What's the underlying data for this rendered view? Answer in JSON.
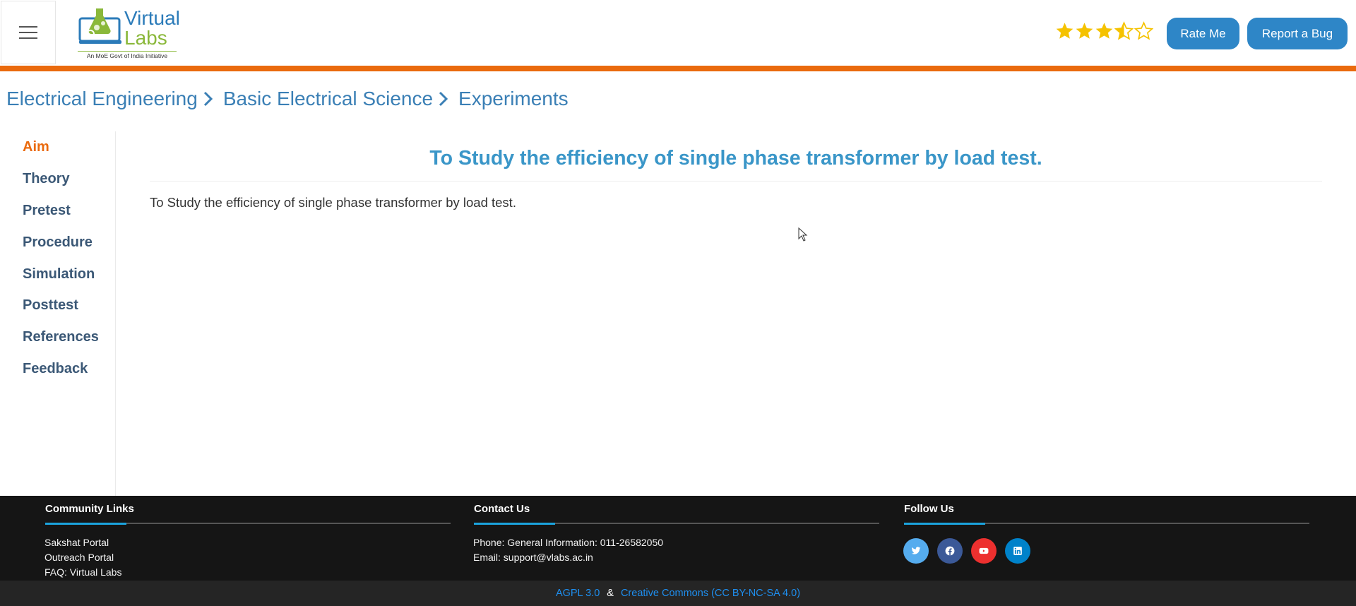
{
  "header": {
    "logo_word1": "Virtual",
    "logo_word2": "Labs",
    "logo_tagline": "An MoE Govt of India Initiative",
    "rating": 3.5,
    "rating_max": 5,
    "rate_me_label": "Rate Me",
    "report_bug_label": "Report a Bug",
    "accent_color": "#ea6a0d",
    "button_color": "#2e86c7",
    "star_color": "#f5c200"
  },
  "breadcrumb": [
    "Electrical Engineering",
    "Basic Electrical Science",
    "Experiments"
  ],
  "sidebar": {
    "items": [
      {
        "label": "Aim",
        "active": true
      },
      {
        "label": "Theory",
        "active": false
      },
      {
        "label": "Pretest",
        "active": false
      },
      {
        "label": "Procedure",
        "active": false
      },
      {
        "label": "Simulation",
        "active": false
      },
      {
        "label": "Posttest",
        "active": false
      },
      {
        "label": "References",
        "active": false
      },
      {
        "label": "Feedback",
        "active": false
      }
    ]
  },
  "main": {
    "title": "To Study the efficiency of single phase transformer by load test.",
    "text": "To Study the efficiency of single phase transformer by load test."
  },
  "footer": {
    "community": {
      "heading": "Community Links",
      "links": [
        "Sakshat Portal",
        "Outreach Portal",
        "FAQ: Virtual Labs"
      ]
    },
    "contact": {
      "heading": "Contact Us",
      "lines": [
        "Phone: General Information: 011-26582050",
        "Email: support@vlabs.ac.in"
      ]
    },
    "follow": {
      "heading": "Follow Us",
      "icons": [
        {
          "name": "twitter-icon",
          "color": "#55acee"
        },
        {
          "name": "facebook-icon",
          "color": "#3b5998"
        },
        {
          "name": "youtube-icon",
          "color": "#ed302f"
        },
        {
          "name": "linkedin-icon",
          "color": "#0082ca"
        }
      ]
    },
    "license_1": "AGPL 3.0",
    "license_sep": "&",
    "license_2": "Creative Commons (CC BY-NC-SA 4.0)"
  }
}
